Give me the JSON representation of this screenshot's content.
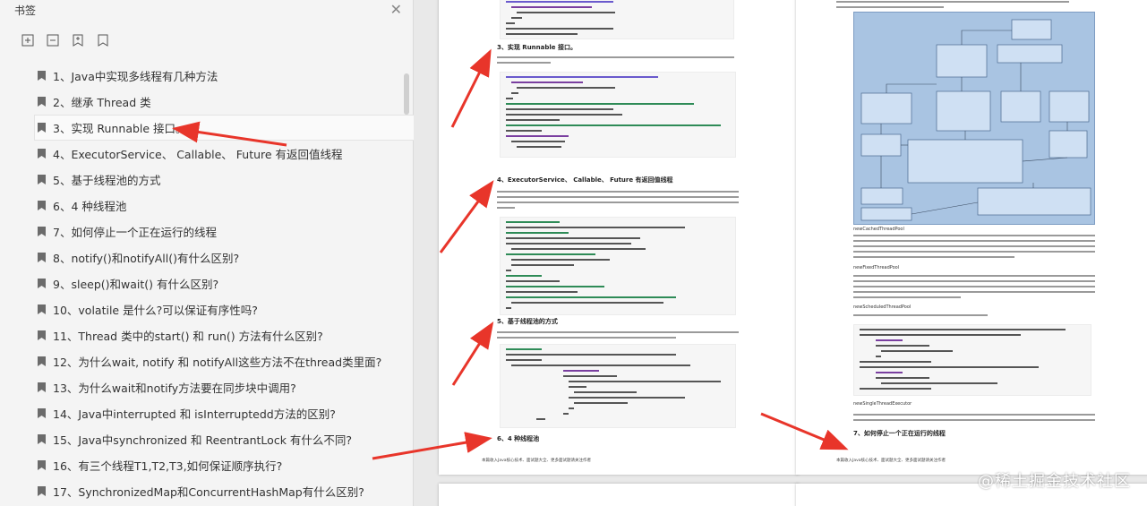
{
  "sidebar": {
    "title": "书签",
    "close_icon": "close-icon",
    "tools": [
      "expand-all-icon",
      "collapse-all-icon",
      "add-bookmark-icon",
      "bookmark-icon"
    ],
    "items": [
      {
        "label": "1、Java中实现多线程有几种方法"
      },
      {
        "label": "2、继承 Thread 类"
      },
      {
        "label": "3、实现 Runnable 接口。"
      },
      {
        "label": "4、ExecutorService、 Callable、 Future 有返回值线程"
      },
      {
        "label": "5、基于线程池的方式"
      },
      {
        "label": "6、4 种线程池"
      },
      {
        "label": "7、如何停止一个正在运行的线程"
      },
      {
        "label": "8、notify()和notifyAll()有什么区别?"
      },
      {
        "label": "9、sleep()和wait() 有什么区别?"
      },
      {
        "label": "10、volatile 是什么?可以保证有序性吗?"
      },
      {
        "label": "11、Thread 类中的start() 和 run() 方法有什么区别?"
      },
      {
        "label": "12、为什么wait, notify 和 notifyAll这些方法不在thread类里面?"
      },
      {
        "label": "13、为什么wait和notify方法要在同步块中调用?"
      },
      {
        "label": "14、Java中interrupted 和 isInterruptedd方法的区别?"
      },
      {
        "label": "15、Java中synchronized 和 ReentrantLock 有什么不同?"
      },
      {
        "label": "16、有三个线程T1,T2,T3,如何保证顺序执行?"
      },
      {
        "label": "17、SynchronizedMap和ConcurrentHashMap有什么区别?"
      }
    ],
    "selected_index": 2
  },
  "doc": {
    "left_page": {
      "sections": [
        "3、实现 Runnable 接口。",
        "4、ExecutorService、 Callable、 Future 有返回值线程",
        "5、基于线程池的方式",
        "6、4 种线程池"
      ],
      "footer": "本篇收入Java核心技术、面试题大全、更多面试题请关注作者"
    },
    "right_page": {
      "headings": [
        "newCachedThreadPool",
        "newFixedThreadPool",
        "newScheduledThreadPool",
        "newSingleThreadExecutor"
      ],
      "sections": [
        "7、如何停止一个正在运行的线程"
      ],
      "footer": "本篇收入Java核心技术、面试题大全、更多面试题请关注作者"
    },
    "watermark": "@稀土掘金技术社区"
  },
  "colors": {
    "arrow": "#e8352a",
    "diagram_bg": "#a9c4e2"
  }
}
